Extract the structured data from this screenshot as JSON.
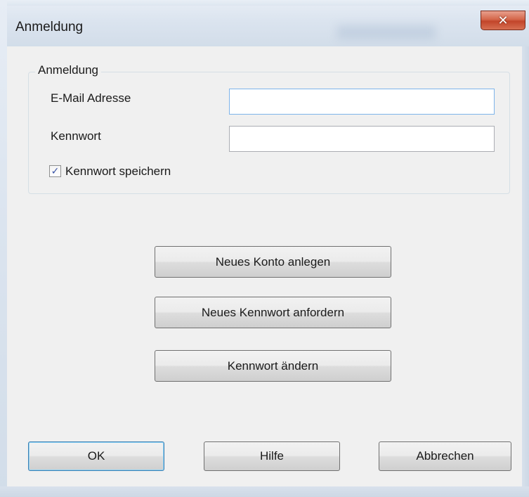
{
  "window": {
    "title": "Anmeldung",
    "close_symbol": "✕"
  },
  "group": {
    "legend": "Anmeldung",
    "email_label": "E-Mail Adresse",
    "email_value": "",
    "password_label": "Kennwort",
    "password_value": "",
    "remember_label": "Kennwort speichern",
    "remember_checked": true
  },
  "actions": {
    "new_account": "Neues Konto anlegen",
    "request_password": "Neues Kennwort anfordern",
    "change_password": "Kennwort ändern"
  },
  "footer": {
    "ok": "OK",
    "help": "Hilfe",
    "cancel": "Abbrechen"
  },
  "colors": {
    "close_button": "#c2452a",
    "checkmark": "#3a54a6",
    "default_button_border": "#3c7fb1"
  }
}
